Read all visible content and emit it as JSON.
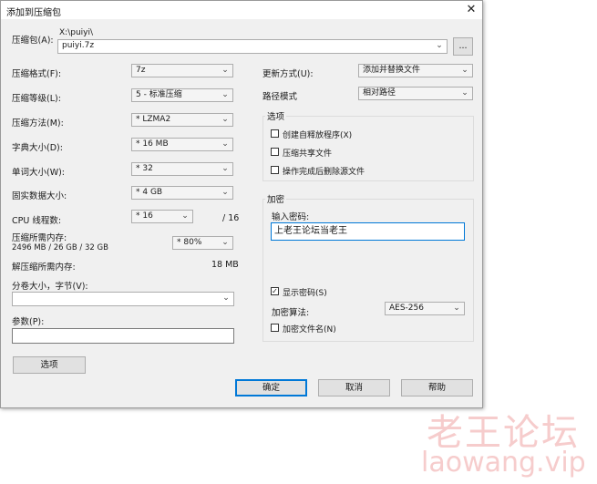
{
  "window": {
    "title": "添加到压缩包",
    "close_glyph": "✕"
  },
  "archive": {
    "label": "压缩包(A):",
    "path": "X:\\puiyi\\",
    "filename": "puiyi.7z",
    "browse_label": "..."
  },
  "left": {
    "format_label": "压缩格式(F):",
    "format_value": "7z",
    "level_label": "压缩等级(L):",
    "level_value": "5 - 标准压缩",
    "method_label": "压缩方法(M):",
    "method_value": "* LZMA2",
    "dict_label": "字典大小(D):",
    "dict_value": "* 16 MB",
    "word_label": "单词大小(W):",
    "word_value": "* 32",
    "solid_label": "固实数据大小:",
    "solid_value": "* 4 GB",
    "threads_label": "CPU 线程数:",
    "threads_value": "* 16",
    "threads_total": "/ 16",
    "mem_label": "压缩所需内存:",
    "mem_detail": "2496 MB / 26 GB / 32 GB",
    "mem_value": "* 80%",
    "decomp_label": "解压缩所需内存:",
    "decomp_value": "18 MB",
    "split_label": "分卷大小，字节(V):",
    "split_value": "",
    "params_label": "参数(P):",
    "params_value": "",
    "options_button": "选项"
  },
  "right": {
    "update_label": "更新方式(U):",
    "update_value": "添加并替换文件",
    "pathmode_label": "路径模式",
    "pathmode_value": "相对路径",
    "options_group": "选项",
    "opt_sfx": "创建自释放程序(X)",
    "opt_shared": "压缩共享文件",
    "opt_delete": "操作完成后删除源文件",
    "encrypt_group": "加密",
    "password_label": "输入密码:",
    "password_value": "上老王论坛当老王",
    "show_password": "显示密码(S)",
    "show_password_check": "✓",
    "enc_method_label": "加密算法:",
    "enc_method_value": "AES-256",
    "encrypt_names": "加密文件名(N)"
  },
  "buttons": {
    "ok": "确定",
    "cancel": "取消",
    "help": "帮助"
  },
  "watermark": {
    "cn": "老王论坛",
    "en": "laowang.vip"
  },
  "icons": {
    "chevron": "⌄"
  }
}
